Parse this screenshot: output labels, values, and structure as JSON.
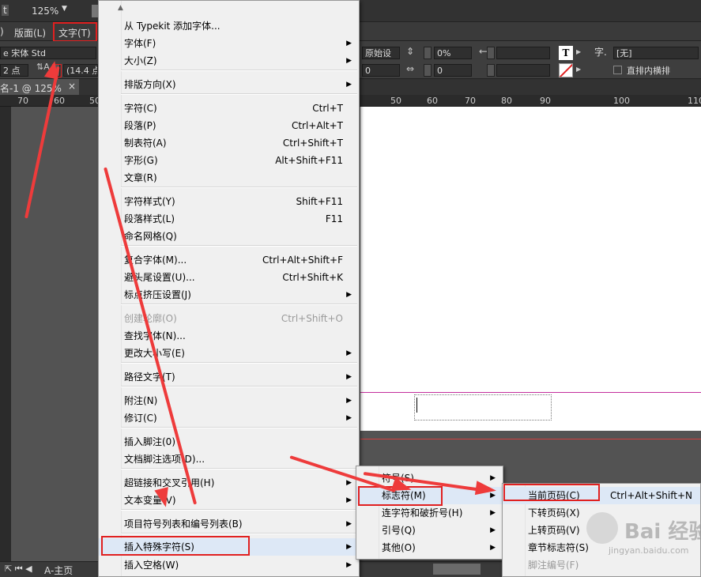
{
  "toolbar": {
    "zoom": "125%",
    "menu_layout": "版面(L)",
    "menu_type": "文字(T)",
    "font_name": "e 宋体 Std",
    "font_size": "2 点",
    "leading": "(14.4 点",
    "tracking_label": "原始设",
    "tracking_value": "0%",
    "baseline": "0",
    "baseline2": "0",
    "char_style": "[无]",
    "char_label": "字.",
    "vertical_label": "直排内横排",
    "left_edge": "t"
  },
  "document_tab": {
    "title": "名-1 @ 125%",
    "close": "×"
  },
  "ruler": {
    "labels": [
      "70",
      "60",
      "50",
      "40",
      "50",
      "60",
      "70",
      "80",
      "90",
      "100",
      "110"
    ]
  },
  "status_bar": {
    "page_label": "A-主页"
  },
  "main_menu": {
    "items": [
      {
        "label": "从 Typekit 添加字体...",
        "shortcut": "",
        "submenu": false,
        "disabled": false
      },
      {
        "label": "字体(F)",
        "shortcut": "",
        "submenu": true,
        "disabled": false
      },
      {
        "label": "大小(Z)",
        "shortcut": "",
        "submenu": true,
        "disabled": false
      },
      {
        "label": "排版方向(X)",
        "shortcut": "",
        "submenu": true,
        "disabled": false
      },
      {
        "label": "字符(C)",
        "shortcut": "Ctrl+T",
        "submenu": false,
        "disabled": false
      },
      {
        "label": "段落(P)",
        "shortcut": "Ctrl+Alt+T",
        "submenu": false,
        "disabled": false
      },
      {
        "label": "制表符(A)",
        "shortcut": "Ctrl+Shift+T",
        "submenu": false,
        "disabled": false
      },
      {
        "label": "字形(G)",
        "shortcut": "Alt+Shift+F11",
        "submenu": false,
        "disabled": false
      },
      {
        "label": "文章(R)",
        "shortcut": "",
        "submenu": false,
        "disabled": false
      },
      {
        "label": "字符样式(Y)",
        "shortcut": "Shift+F11",
        "submenu": false,
        "disabled": false
      },
      {
        "label": "段落样式(L)",
        "shortcut": "F11",
        "submenu": false,
        "disabled": false
      },
      {
        "label": "命名网格(Q)",
        "shortcut": "",
        "submenu": false,
        "disabled": false
      },
      {
        "label": "复合字体(M)...",
        "shortcut": "Ctrl+Alt+Shift+F",
        "submenu": false,
        "disabled": false
      },
      {
        "label": "避头尾设置(U)...",
        "shortcut": "Ctrl+Shift+K",
        "submenu": false,
        "disabled": false
      },
      {
        "label": "标点挤压设置(J)",
        "shortcut": "",
        "submenu": true,
        "disabled": false
      },
      {
        "label": "创建轮廓(O)",
        "shortcut": "Ctrl+Shift+O",
        "submenu": false,
        "disabled": true
      },
      {
        "label": "查找字体(N)...",
        "shortcut": "",
        "submenu": false,
        "disabled": false
      },
      {
        "label": "更改大小写(E)",
        "shortcut": "",
        "submenu": true,
        "disabled": false
      },
      {
        "label": "路径文字(T)",
        "shortcut": "",
        "submenu": true,
        "disabled": false
      },
      {
        "label": "附注(N)",
        "shortcut": "",
        "submenu": true,
        "disabled": false
      },
      {
        "label": "修订(C)",
        "shortcut": "",
        "submenu": true,
        "disabled": false
      },
      {
        "label": "插入脚注(0)",
        "shortcut": "",
        "submenu": false,
        "disabled": false
      },
      {
        "label": "文档脚注选项(D)...",
        "shortcut": "",
        "submenu": false,
        "disabled": false
      },
      {
        "label": "超链接和交叉引用(H)",
        "shortcut": "",
        "submenu": true,
        "disabled": false
      },
      {
        "label": "文本变量(V)",
        "shortcut": "",
        "submenu": true,
        "disabled": false
      },
      {
        "label": "项目符号列表和编号列表(B)",
        "shortcut": "",
        "submenu": true,
        "disabled": false
      },
      {
        "label": "插入特殊字符(S)",
        "shortcut": "",
        "submenu": true,
        "disabled": false
      },
      {
        "label": "插入空格(W)",
        "shortcut": "",
        "submenu": true,
        "disabled": false
      }
    ]
  },
  "sub_menu": {
    "items": [
      {
        "label": "符号(S)",
        "submenu": true
      },
      {
        "label": "标志符(M)",
        "submenu": true
      },
      {
        "label": "连字符和破折号(H)",
        "submenu": true
      },
      {
        "label": "引号(Q)",
        "submenu": true
      },
      {
        "label": "其他(O)",
        "submenu": true
      }
    ]
  },
  "sub_sub_menu": {
    "items": [
      {
        "label": "当前页码(C)",
        "shortcut": "Ctrl+Alt+Shift+N",
        "disabled": false
      },
      {
        "label": "下转页码(X)",
        "shortcut": "",
        "disabled": false
      },
      {
        "label": "上转页码(V)",
        "shortcut": "",
        "disabled": false
      },
      {
        "label": "章节标志符(S)",
        "shortcut": "",
        "disabled": false
      },
      {
        "label": "脚注编号(F)",
        "shortcut": "",
        "disabled": true
      }
    ]
  },
  "watermark": {
    "text": "Bai 经验",
    "url": "jingyan.baidu.com"
  },
  "colors": {
    "menu_bg": "#f0f0f0",
    "highlight": "#dde8f6",
    "annotation_red": "#e02020",
    "arrow_red": "#ee3b3b",
    "guide_magenta": "#c42e9c"
  }
}
